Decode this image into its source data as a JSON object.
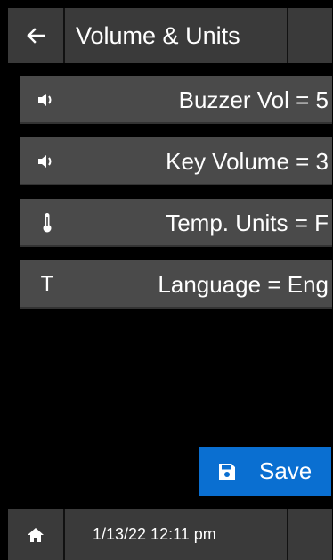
{
  "header": {
    "title": "Volume & Units",
    "back_icon": "arrow-left-icon"
  },
  "settings": [
    {
      "label": "Buzzer Vol = 5",
      "icon": "speaker-icon"
    },
    {
      "label": "Key Volume = 3",
      "icon": "speaker-icon"
    },
    {
      "label": "Temp. Units = F",
      "icon": "thermometer-icon"
    },
    {
      "label": "Language = Eng",
      "icon": "T"
    }
  ],
  "save": {
    "label": "Save",
    "icon": "floppy-disk-icon",
    "color": "#0a6fd1"
  },
  "footer": {
    "datetime": "1/13/22 12:11 pm",
    "home_icon": "home-icon"
  },
  "colors": {
    "panel": "#3a3a3a",
    "row": "#4a4a4a",
    "background": "#000000"
  }
}
